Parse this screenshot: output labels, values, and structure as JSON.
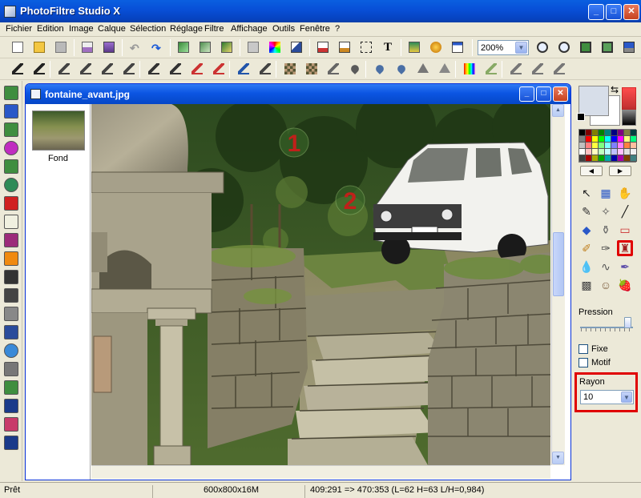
{
  "window": {
    "title": "PhotoFiltre Studio X",
    "min": "_",
    "max": "□",
    "close": "✕"
  },
  "menu": [
    "Fichier",
    "Edition",
    "Image",
    "Calque",
    "Sélection",
    "Réglage",
    "Filtre",
    "Affichage",
    "Outils",
    "Fenêtre",
    "?"
  ],
  "toolbar": {
    "zoom_value": "200%",
    "text_tool_glyph": "T"
  },
  "document": {
    "title": "fontaine_avant.jpg",
    "layer_name": "Fond"
  },
  "annotations": {
    "marker1": "1",
    "marker2": "2"
  },
  "right_panel": {
    "pression_label": "Pression",
    "fixe_label": "Fixe",
    "motif_label": "Motif",
    "rayon_label": "Rayon",
    "rayon_value": "10",
    "pression_level": 0.95
  },
  "status": {
    "state": "Prêt",
    "size": "600x800x16M",
    "coords": "409:291 => 470:353 (L=62  H=63  L/H=0,984)"
  },
  "colors": {
    "titlebar": "#0A5FE0",
    "highlight": "#E00000",
    "face": "#ECE9D8"
  },
  "icons": {
    "toolbar1": [
      "new-file-icon",
      "open-icon",
      "save-icon",
      "print-icon",
      "scanner-icon",
      "undo-icon",
      "redo-icon",
      "copy-icon",
      "paste-icon",
      "paste-layer-icon",
      "frame-icon",
      "color-mode-icon",
      "transform-icon",
      "document-icon",
      "document-alt-icon",
      "selection-icon",
      "text-icon",
      "image-effect-icon",
      "filter-icon",
      "window-icon",
      "zoom-in-icon",
      "zoom-out-icon",
      "fit-icon",
      "actual-size-icon",
      "fullscreen-icon"
    ],
    "toolbar2": [
      "auto-contrast-icon",
      "auto-level-icon",
      "brightness-minus-icon",
      "brightness-plus-icon",
      "contrast-minus-icon",
      "contrast-plus-icon",
      "gamma-minus-icon",
      "gamma-plus-icon",
      "saturation-minus-icon",
      "saturation-plus-icon",
      "levels-icon",
      "curves-icon",
      "mosaic-icon",
      "pixel-icon",
      "noise-icon",
      "blur-icon",
      "drop-icon",
      "sharpen-icon",
      "triangle-icon",
      "emboss-icon",
      "rainbow-icon",
      "palette-icon",
      "book-icon",
      "cylinder-icon",
      "print-small-icon"
    ],
    "left_tools": [
      "calculator-icon",
      "layers-icon",
      "monitor-icon",
      "orb-icon",
      "plugin-icon",
      "sphere-icon",
      "star-icon",
      "page-icon",
      "gradient-icon",
      "orange-icon",
      "fx-icon",
      "flower-icon",
      "mask-icon",
      "histogram-icon",
      "drop-icon",
      "book-icon",
      "screen-icon",
      "save-2000-icon",
      "record-icon",
      "save-html-icon"
    ],
    "right_tools": [
      "pointer-icon",
      "rect-select-icon",
      "hand-icon",
      "eyedropper-icon",
      "magic-wand-icon",
      "line-icon",
      "bucket-icon",
      "spray-icon",
      "eraser-icon",
      "brush-icon",
      "pen-icon",
      "clone-stamp-icon",
      "blur-drop-icon",
      "smudge-icon",
      "pipette-icon",
      "grid-icon",
      "portrait-icon",
      "strawberry-icon"
    ]
  }
}
